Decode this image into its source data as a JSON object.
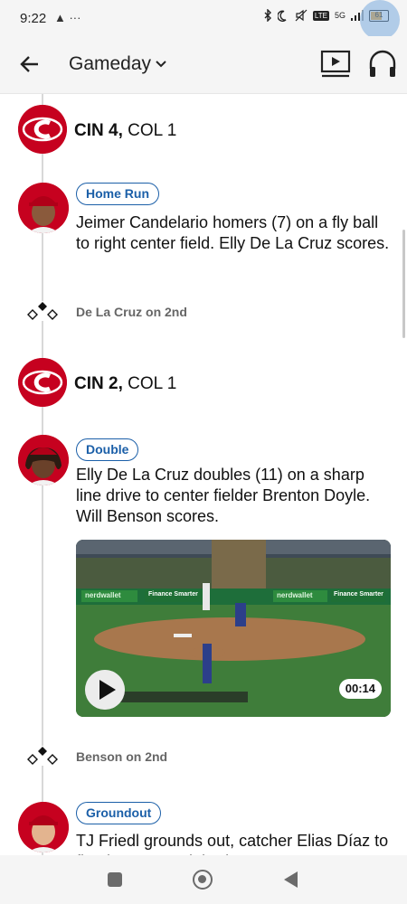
{
  "status_bar": {
    "time": "9:22",
    "left_icons": "▲ ···",
    "network": "5G",
    "battery": "61"
  },
  "header": {
    "title": "Gameday",
    "dropdown_icon": "chevron-down-icon",
    "back_icon": "arrow-left-icon",
    "tv_icon": "tv-play-icon",
    "audio_icon": "headphones-icon"
  },
  "feed": {
    "scores": [
      {
        "team_a": "CIN 4,",
        "team_b": "COL 1"
      },
      {
        "team_a": "CIN 2,",
        "team_b": "COL 1"
      }
    ],
    "plays": [
      {
        "badge": "Home Run",
        "description": "Jeimer Candelario homers (7) on a fly ball to right center field. Elly De La Cruz scores."
      },
      {
        "badge": "Double",
        "description": "Elly De La Cruz doubles (11) on a sharp line drive to center fielder Brenton Doyle. Will Benson scores.",
        "video_duration": "00:14"
      },
      {
        "badge": "Groundout",
        "description": "TJ Friedl grounds out, catcher Elias Díaz to first baseman Elehuris Montero."
      }
    ],
    "runners": [
      {
        "text": "De La Cruz on 2nd"
      },
      {
        "text": "Benson on 2nd"
      }
    ],
    "video_overlay": {
      "ad_left": "nerdwallet",
      "ad_mid": "Finance Smarter",
      "ad_right": "nerdwallet",
      "ad_right2": "Finance Smarter"
    }
  },
  "colors": {
    "reds": "#c6011f",
    "badge_blue": "#1b5fa8",
    "header_bg": "#f5f5f5"
  }
}
